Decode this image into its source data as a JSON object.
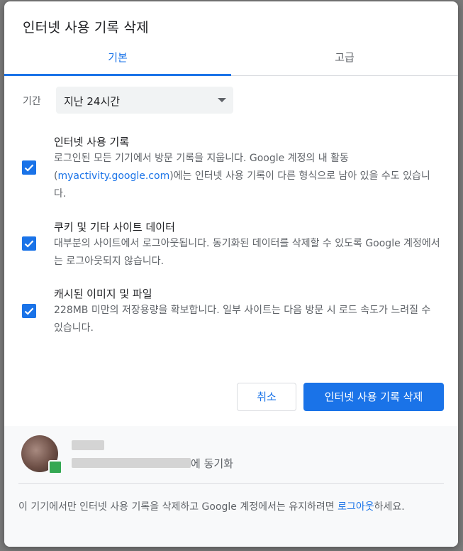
{
  "dialog": {
    "title": "인터넷 사용 기록 삭제"
  },
  "tabs": [
    {
      "label": "기본",
      "selected": true
    },
    {
      "label": "고급",
      "selected": false
    }
  ],
  "time_range": {
    "label": "기간",
    "selected": "지난 24시간"
  },
  "options": [
    {
      "title": "인터넷 사용 기록",
      "desc_before": "로그인된 모든 기기에서 방문 기록을 지웁니다. Google 계정의 내 활동 (",
      "link": "myactivity.google.com",
      "desc_after": ")에는 인터넷 사용 기록이 다른 형식으로 남아 있을 수도 있습니다.",
      "checked": true
    },
    {
      "title": "쿠키 및 기타 사이트 데이터",
      "desc": "대부분의 사이트에서 로그아웃됩니다. 동기화된 데이터를 삭제할 수 있도록 Google 계정에서는 로그아웃되지 않습니다.",
      "checked": true
    },
    {
      "title": "캐시된 이미지 및 파일",
      "desc": "228MB 미만의 저장용량을 확보합니다. 일부 사이트는 다음 방문 시 로드 속도가 느려질 수 있습니다.",
      "checked": true
    }
  ],
  "buttons": {
    "cancel": "취소",
    "clear": "인터넷 사용 기록 삭제"
  },
  "footer": {
    "sync_suffix": "에 동기화",
    "note_before": "이 기기에서만 인터넷 사용 기록을 삭제하고 Google 계정에서는 유지하려면 ",
    "note_link": "로그아웃",
    "note_after": "하세요."
  },
  "colors": {
    "accent": "#1a73e8",
    "text_primary": "#202124",
    "text_secondary": "#5f6368"
  },
  "icons": {
    "checkbox": "checkmark-icon",
    "dropdown": "caret-down-icon"
  }
}
